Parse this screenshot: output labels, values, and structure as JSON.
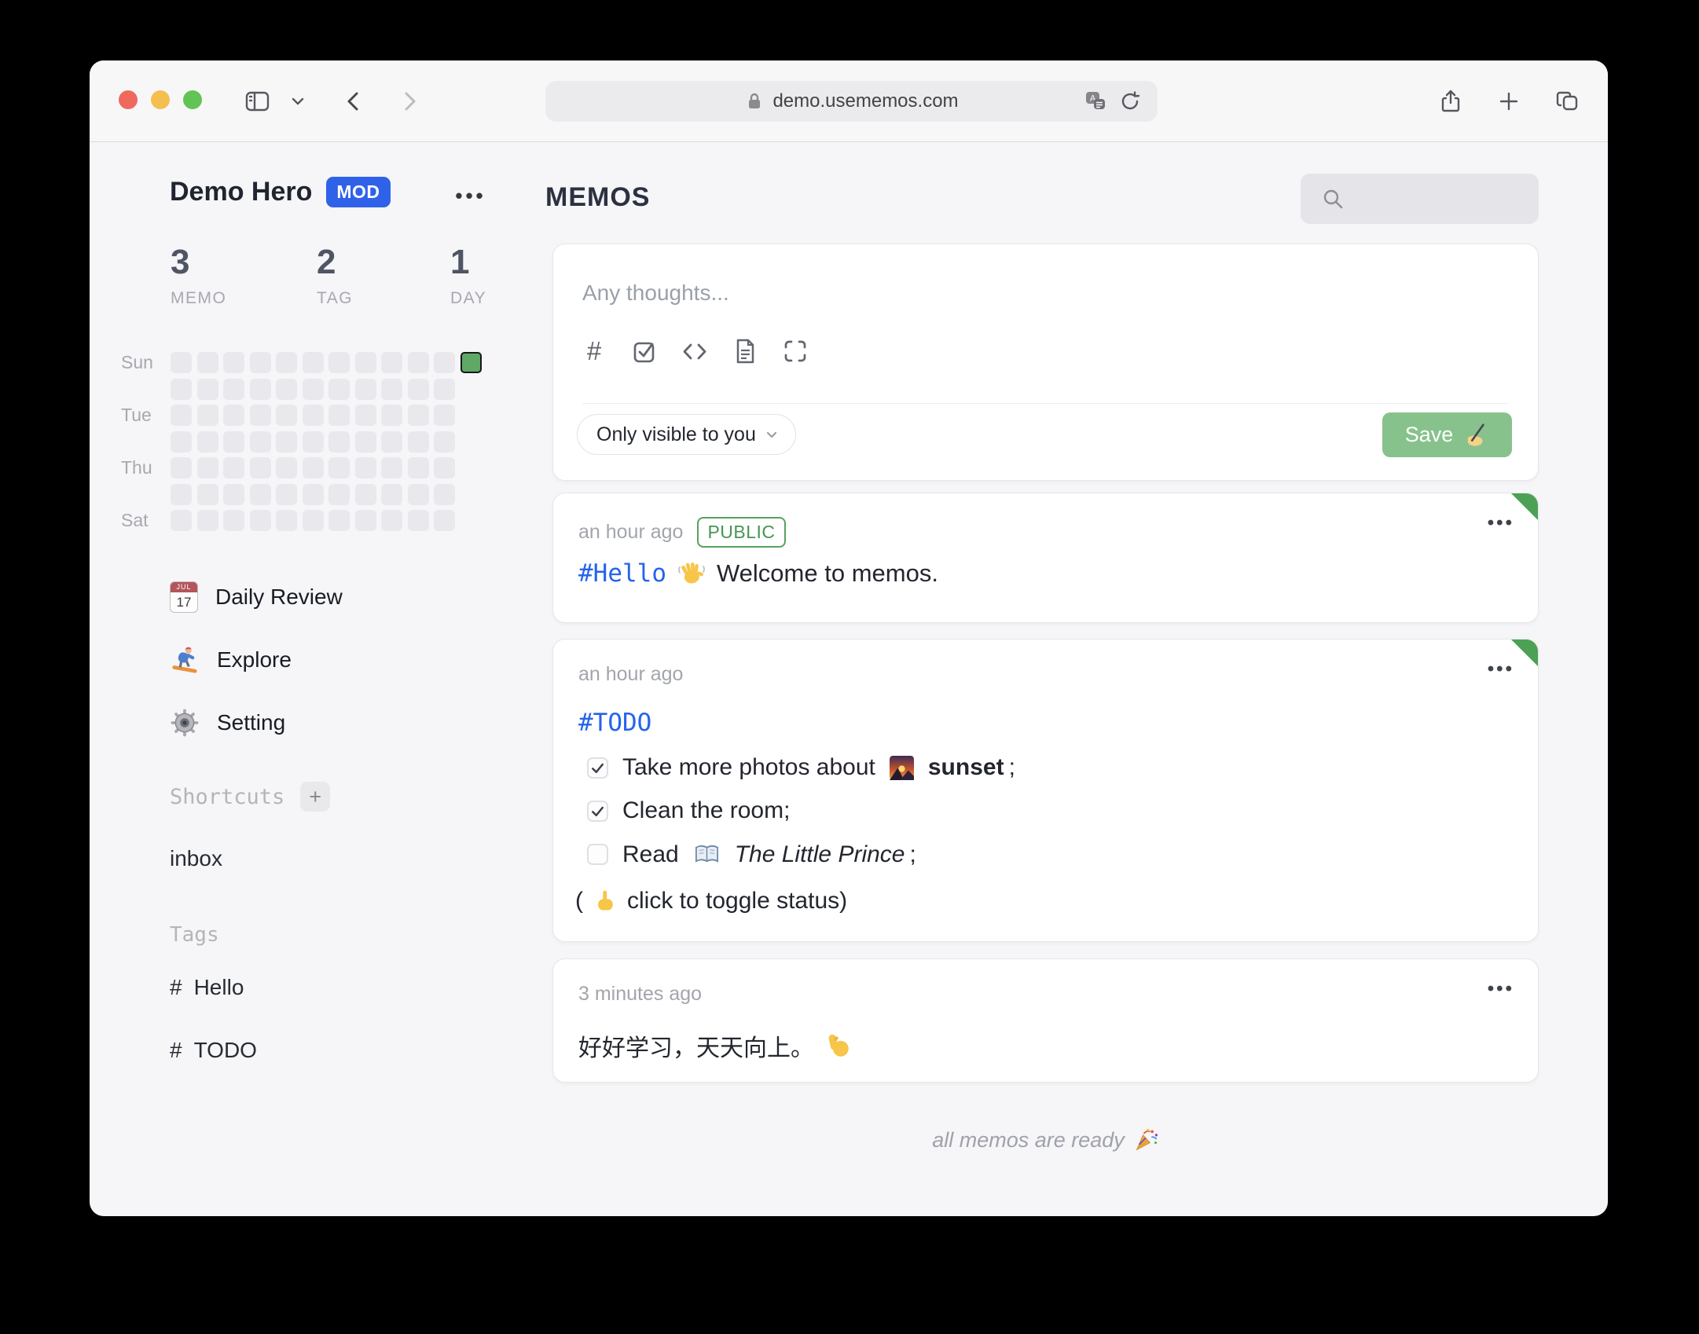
{
  "colors": {
    "accent_blue": "#2f62e9",
    "tag_blue": "#2563eb",
    "save_green": "#87c28c",
    "public_green": "#4ca154",
    "heatmap_active": "#5fa866",
    "traffic_lights": [
      "#ee6a5e",
      "#f5bf4f",
      "#61c454"
    ]
  },
  "browser": {
    "url": "demo.usememos.com"
  },
  "sidebar": {
    "user": {
      "name": "Demo Hero",
      "badge": "MOD",
      "menu": "•••"
    },
    "stats": [
      {
        "value": "3",
        "label": "MEMO"
      },
      {
        "value": "2",
        "label": "TAG"
      },
      {
        "value": "1",
        "label": "DAY"
      }
    ],
    "heatmap": {
      "rows": 7,
      "columns": 12,
      "visible_last_col_rows": 1,
      "active": {
        "col": 11,
        "row": 0
      },
      "row_labels": [
        {
          "label": "Sun",
          "row": 0
        },
        {
          "label": "Tue",
          "row": 2
        },
        {
          "label": "Thu",
          "row": 4
        },
        {
          "label": "Sat",
          "row": 6
        }
      ]
    },
    "menu": [
      {
        "icon": "calendar-icon",
        "label": "Daily Review",
        "icon_month": "JUL",
        "icon_day": "17"
      },
      {
        "icon": "snowboarder-icon",
        "label": "Explore"
      },
      {
        "icon": "gear-icon",
        "label": "Setting"
      }
    ],
    "shortcuts": {
      "label": "Shortcuts",
      "add_label": "+",
      "items": [
        {
          "name": "inbox"
        }
      ]
    },
    "tags": {
      "label": "Tags",
      "items": [
        {
          "prefix": "#",
          "name": "Hello"
        },
        {
          "prefix": "#",
          "name": "TODO"
        }
      ]
    }
  },
  "main": {
    "title": "MEMOS",
    "search": {
      "icon": "search-icon",
      "value": ""
    },
    "editor": {
      "placeholder": "Any thoughts...",
      "toolbar_icons": [
        "hash-icon",
        "checkbox-icon",
        "code-icon",
        "document-icon",
        "fullscreen-icon"
      ],
      "hash_glyph": "#",
      "visibility_label": "Only visible to you",
      "save_label": "Save",
      "save_icon": "writing-hand-icon"
    },
    "memos": [
      {
        "time": "an hour ago",
        "visibility_badge": "PUBLIC",
        "tag": "#Hello",
        "icon": "waving-hand-icon",
        "text": "Welcome to memos.",
        "corner": true,
        "menu": "•••"
      },
      {
        "time": "an hour ago",
        "tag": "#TODO",
        "corner": true,
        "menu": "•••",
        "todos": [
          {
            "checked": true,
            "pre": "Take more photos about",
            "icon": "sunset-icon",
            "emph": "sunset",
            "emph_style": "bold",
            "post": ";"
          },
          {
            "checked": true,
            "pre": "Clean the room;",
            "emph": "",
            "post": ""
          },
          {
            "checked": false,
            "pre": "Read",
            "icon": "open-book-icon",
            "emph": "The Little Prince",
            "emph_style": "italic",
            "post": ";"
          }
        ],
        "note": {
          "open": "(",
          "icon": "pointing-up-icon",
          "text": "click to toggle status)"
        }
      },
      {
        "time": "3 minutes ago",
        "text": "好好学习，天天向上。",
        "icon": "flexed-biceps-icon",
        "corner": false,
        "menu": "•••"
      }
    ],
    "footer": {
      "text": "all memos are ready",
      "icon": "party-popper-icon"
    }
  }
}
